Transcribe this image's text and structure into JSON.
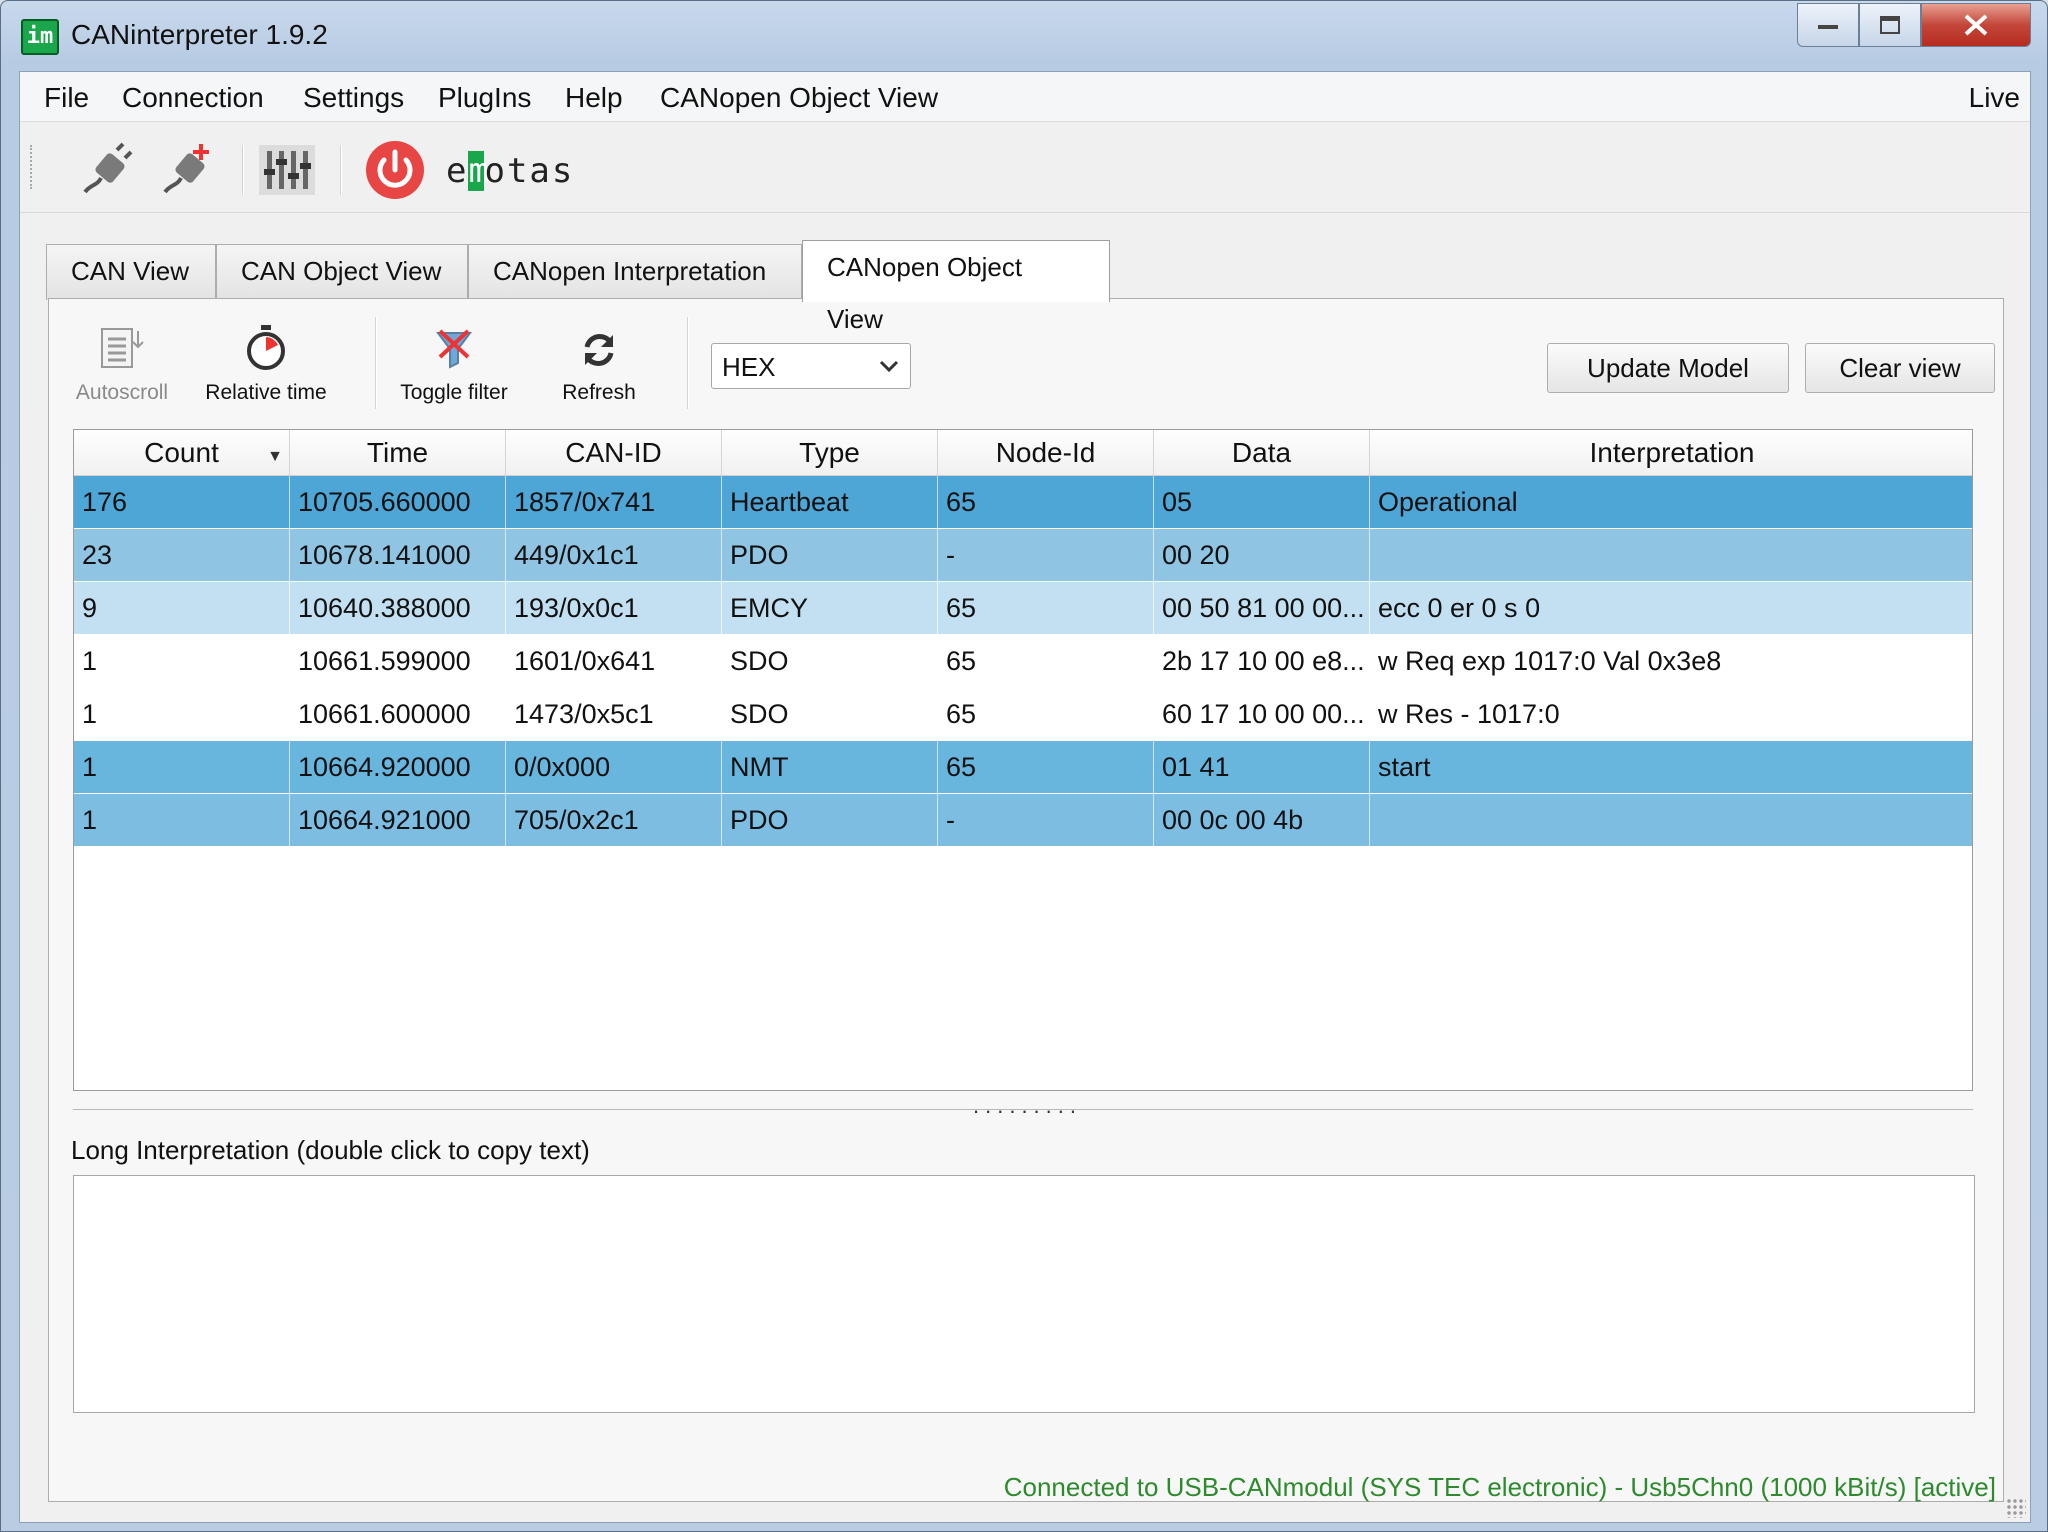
{
  "window": {
    "title": "CANinterpreter 1.9.2",
    "logo_text": "im"
  },
  "menubar": {
    "items": [
      {
        "label": "File"
      },
      {
        "label": "Connection"
      },
      {
        "label": "Settings"
      },
      {
        "label": "PlugIns"
      },
      {
        "label": "Help"
      },
      {
        "label": "CANopen Object View"
      }
    ],
    "right_label": "Live"
  },
  "toolbar": {
    "brand_text_pre": "e",
    "brand_text_mark": "m",
    "brand_text_post": "otas"
  },
  "tabs": [
    {
      "label": "CAN View",
      "active": false
    },
    {
      "label": "CAN Object View",
      "active": false
    },
    {
      "label": "CANopen Interpretation",
      "active": false
    },
    {
      "label": "CANopen Object View",
      "active": true
    }
  ],
  "panel": {
    "buttons": {
      "autoscroll": "Autoscroll",
      "relative_time": "Relative time",
      "toggle_filter": "Toggle filter",
      "refresh": "Refresh"
    },
    "format_select": {
      "value": "HEX"
    },
    "update_model": "Update Model",
    "clear_view": "Clear view"
  },
  "table": {
    "columns": [
      "Count",
      "Time",
      "CAN-ID",
      "Type",
      "Node-Id",
      "Data",
      "Interpretation"
    ],
    "rows": [
      {
        "cells": [
          "176",
          "10705.660000",
          "1857/0x741",
          "Heartbeat",
          "65",
          "05",
          "Operational"
        ],
        "bg": "#4ea6d6"
      },
      {
        "cells": [
          "23",
          "10678.141000",
          "449/0x1c1",
          "PDO",
          "-",
          "00 20",
          ""
        ],
        "bg": "#8fc4e3"
      },
      {
        "cells": [
          "9",
          "10640.388000",
          "193/0x0c1",
          "EMCY",
          "65",
          "00 50 81 00 00...",
          "ecc    0 er  0 s  0"
        ],
        "bg": "#c2e0f1"
      },
      {
        "cells": [
          "1",
          "10661.599000",
          "1601/0x641",
          "SDO",
          "65",
          "2b 17 10 00 e8...",
          "w Req exp 1017:0 Val 0x3e8"
        ],
        "bg": "#ffffff"
      },
      {
        "cells": [
          "1",
          "10661.600000",
          "1473/0x5c1",
          "SDO",
          "65",
          "60 17 10 00 00...",
          "w Res - 1017:0"
        ],
        "bg": "#ffffff"
      },
      {
        "cells": [
          "1",
          "10664.920000",
          "0/0x000",
          "NMT",
          "65",
          "01 41",
          "start"
        ],
        "bg": "#68b5de"
      },
      {
        "cells": [
          "1",
          "10664.921000",
          "705/0x2c1",
          "PDO",
          "-",
          "00 0c 00 4b",
          ""
        ],
        "bg": "#7dbde2"
      }
    ]
  },
  "long_interpretation": {
    "label": "Long Interpretation (double click to copy text)",
    "text": ""
  },
  "status": {
    "text": "Connected to USB-CANmodul (SYS TEC electronic) - Usb5Chn0 (1000 kBit/s)  [active]"
  }
}
